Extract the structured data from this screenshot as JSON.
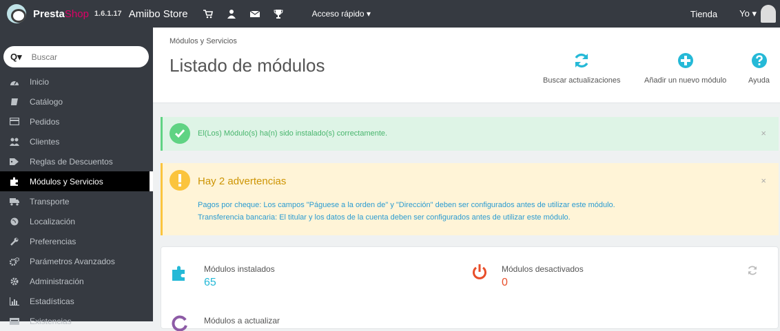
{
  "app": {
    "brand_main": "Presta",
    "brand_accent": "Shop",
    "version": "1.6.1.17",
    "store_name": "Amiibo Store",
    "quick_access": "Acceso rápido ▾",
    "store_link": "Tienda",
    "user_menu": "Yo ▾"
  },
  "sidebar": {
    "search_placeholder": "Buscar",
    "search_caret": "Q▾",
    "items": [
      {
        "label": "Inicio",
        "icon": "dashboard-icon"
      },
      {
        "label": "Catálogo",
        "icon": "book-icon"
      },
      {
        "label": "Pedidos",
        "icon": "credit-card-icon"
      },
      {
        "label": "Clientes",
        "icon": "users-icon"
      },
      {
        "label": "Reglas de Descuentos",
        "icon": "tag-icon"
      },
      {
        "label": "Módulos y Servicios",
        "icon": "puzzle-icon"
      },
      {
        "label": "Transporte",
        "icon": "truck-icon"
      },
      {
        "label": "Localización",
        "icon": "globe-icon"
      },
      {
        "label": "Preferencias",
        "icon": "wrench-icon"
      },
      {
        "label": "Parámetros Avanzados",
        "icon": "cogs-icon"
      },
      {
        "label": "Administración",
        "icon": "gear-icon"
      },
      {
        "label": "Estadísticas",
        "icon": "bar-chart-icon"
      },
      {
        "label": "Existencias",
        "icon": "stock-icon"
      }
    ],
    "active_index": 5
  },
  "header": {
    "breadcrumb": "Módulos y Servicios",
    "title": "Listado de módulos",
    "toolbar": {
      "check_updates": "Buscar actualizaciones",
      "add_module": "Añadir un nuevo módulo",
      "help": "Ayuda"
    }
  },
  "alerts": {
    "success": "El(Los) Módulo(s) ha(n) sido instalado(s) correctamente.",
    "warning_title": "Hay 2 advertencias",
    "warning_lines": [
      "Pagos por cheque: Los campos \"Páguese a la orden de\" y \"Dirección\" deben ser configurados antes de utilizar este módulo.",
      "Transferencia bancaria: El titular y los datos de la cuenta deben ser configurados antes de utilizar este módulo."
    ],
    "close": "×"
  },
  "stats": {
    "installed_label": "Módulos instalados",
    "installed_value": "65",
    "disabled_label": "Módulos desactivados",
    "disabled_value": "0",
    "to_update_label": "Módulos a actualizar"
  },
  "colors": {
    "topbar": "#363a41",
    "brand_accent": "#df0067",
    "link_blue": "#25b9d7",
    "success_green": "#5fd383",
    "warning_yellow": "#fbc43d",
    "danger_red": "#e84e2a",
    "update_purple": "#8d5ba6"
  }
}
